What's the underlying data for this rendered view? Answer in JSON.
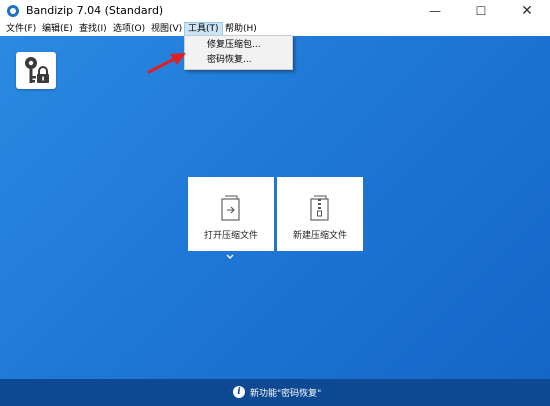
{
  "window": {
    "title": "Bandizip 7.04 (Standard)",
    "minimize": "—",
    "maximize": "☐",
    "close": "✕"
  },
  "menubar": {
    "items": [
      {
        "label": "文件(F)"
      },
      {
        "label": "编辑(E)"
      },
      {
        "label": "查找(I)"
      },
      {
        "label": "选项(O)"
      },
      {
        "label": "视图(V)"
      },
      {
        "label": "工具(T)"
      },
      {
        "label": "帮助(H)"
      }
    ],
    "active": "工具(T)"
  },
  "tools_menu": {
    "items": [
      {
        "label": "修复压缩包..."
      },
      {
        "label": "密码恢复..."
      }
    ]
  },
  "main": {
    "open_archive_label": "打开压缩文件",
    "new_archive_label": "新建压缩文件"
  },
  "footer": {
    "info_glyph": "i",
    "text": "新功能\"密码恢复\""
  },
  "colors": {
    "background_top": "#2a8ae2",
    "background_bottom": "#1565c7",
    "footer": "#0d4a93",
    "menu_highlight": "#cce4f7",
    "annotation_arrow": "#e02020"
  },
  "icons": {
    "app": "bandizip-logo-icon",
    "key_lock": "key-lock-icon",
    "open": "open-file-icon",
    "new": "zip-file-icon",
    "expand": "chevron-down-icon",
    "info": "info-icon",
    "annotation": "red-arrow-icon"
  }
}
